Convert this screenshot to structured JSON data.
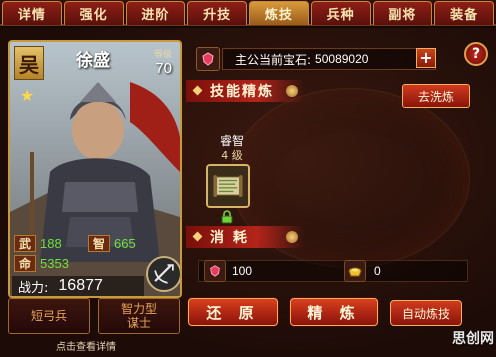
{
  "tabs": [
    {
      "label": "详情",
      "active": false
    },
    {
      "label": "强化",
      "active": false
    },
    {
      "label": "进阶",
      "active": false
    },
    {
      "label": "升技",
      "active": false
    },
    {
      "label": "炼技",
      "active": true
    },
    {
      "label": "兵种",
      "active": false
    },
    {
      "label": "副将",
      "active": false
    },
    {
      "label": "装备",
      "active": false
    }
  ],
  "general": {
    "faction": "吴",
    "name": "徐盛",
    "level_label": "等级",
    "level": "70",
    "stats": {
      "wu_label": "武",
      "wu": "188",
      "zhi_label": "智",
      "zhi": "665",
      "ming_label": "命",
      "ming": "5353"
    },
    "power_label": "战力:",
    "power": "16877",
    "troop_type": "短弓兵",
    "role_line1": "智力型",
    "role_line2": "谋士",
    "hint": "点击查看详情"
  },
  "gem": {
    "label": "主公当前宝石:",
    "value": "50089020",
    "plus": "+"
  },
  "help": "?",
  "refine": {
    "section_title": "技能精炼",
    "wash_button": "去洗炼",
    "skill_name": "睿智",
    "skill_level": "4 级"
  },
  "cost": {
    "section_title": "消 耗",
    "gem_cost": "100",
    "gold_cost": "0"
  },
  "actions": {
    "restore": "还 原",
    "refine": "精 炼",
    "auto": "自动炼技"
  },
  "watermark": "思创网",
  "colors": {
    "accent_red": "#b3241a",
    "gold_border": "#c79a3a",
    "stat_green": "#6fe03c"
  }
}
